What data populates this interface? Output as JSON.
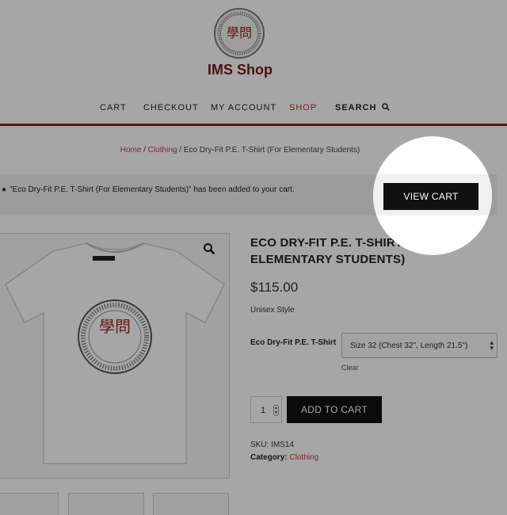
{
  "header": {
    "logo_ring_text": "THE INTERNATIONAL MONTESSORI SCHOOL",
    "logo_ring_sub": "An IMEF school",
    "logo_glyph": "學問",
    "shop_title": "IMS Shop"
  },
  "nav": {
    "items": [
      {
        "label": "CART"
      },
      {
        "label": "CHECKOUT"
      },
      {
        "label": "MY ACCOUNT"
      },
      {
        "label": "SHOP"
      },
      {
        "label": "SEARCH"
      }
    ]
  },
  "breadcrumb": {
    "home": "Home",
    "separator": " / ",
    "category": "Clothing",
    "current": "Eco Dry-Fit P.E. T-Shirt (For Elementary Students)"
  },
  "notice": {
    "message": "\"Eco Dry-Fit P.E. T-Shirt (For Elementary Students)\" has been added to your cart.",
    "view_cart_label": "VIEW CART"
  },
  "product": {
    "title": "ECO DRY-FIT P.E. T-SHIRT (FOR ELEMENTARY STUDENTS)",
    "price": "$115.00",
    "style_note": "Unisex Style",
    "variation_label": "Eco Dry-Fit P.E. T-Shirt",
    "variation_selected": "Size 32 (Chest 32\", Length 21.5\")",
    "clear_label": "Clear",
    "quantity": "1",
    "add_to_cart_label": "ADD TO CART",
    "sku_label": "SKU:",
    "sku_value": "IMS14",
    "category_label": "Category:",
    "category_value": "Clothing"
  },
  "colors": {
    "brand": "#7d1616",
    "link": "#b04848",
    "button": "#111111"
  },
  "icons": {
    "search": "search-icon",
    "zoom": "magnifier-icon"
  }
}
